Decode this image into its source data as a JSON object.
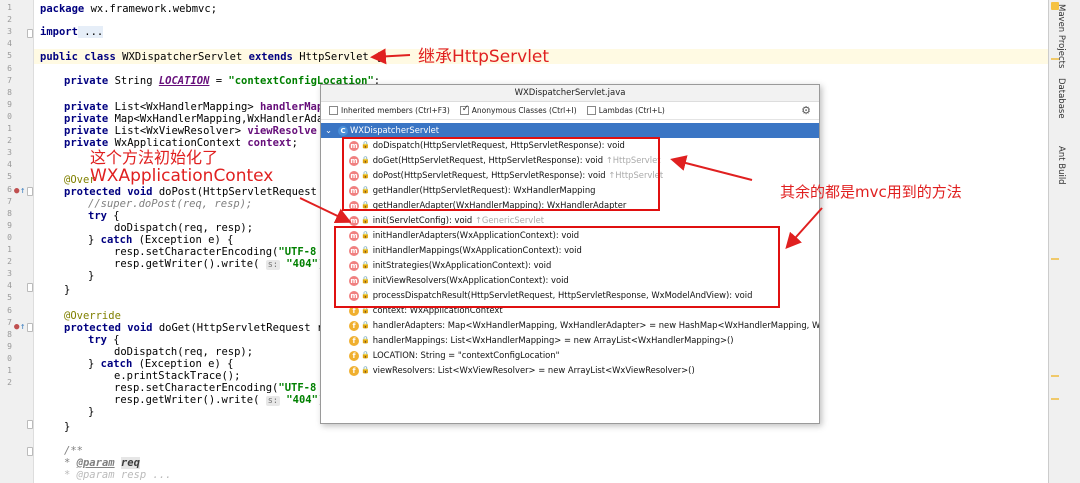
{
  "gutter": {
    "line_numbers": [
      "1",
      "2",
      "3",
      "4",
      "5",
      "6",
      "7",
      "8",
      "9",
      "0",
      "1",
      "2",
      "3",
      "4",
      "5",
      "6",
      "7",
      "8",
      "9",
      "0",
      "1",
      "2",
      "3",
      "4",
      "5",
      "6",
      "7",
      "8",
      "9",
      "0",
      "1",
      "2"
    ]
  },
  "code": {
    "l1": [
      "package",
      " wx.framework.webmvc;"
    ],
    "l3": [
      "import",
      " ..."
    ],
    "l5": [
      "public class",
      " WXDispatcherServlet ",
      "extends",
      " HttpServlet ",
      "{"
    ],
    "l7": [
      "private",
      " String ",
      "LOCATION",
      " = ",
      "\"contextConfigLocation\"",
      ";"
    ],
    "l9": [
      "private",
      " List<WxHandlerMapping> ",
      "handlerMap"
    ],
    "l10": [
      "private",
      " Map<WxHandlerMapping,WxHandlerAda"
    ],
    "l11": [
      "private",
      " List<WxViewResolver> ",
      "viewResolve"
    ],
    "l12": [
      "private",
      " WxApplicationContext ",
      "context",
      ";"
    ],
    "l14": "@Over",
    "l15": [
      "protected void",
      " doPost(HttpServletRequest"
    ],
    "l16": "//super.doPost(req, resp);",
    "l17": [
      "try",
      " {"
    ],
    "l18": "doDispatch(req, resp);",
    "l19": [
      "} ",
      "catch",
      " (Exception e) {"
    ],
    "l20": [
      "resp.setCharacterEncoding(",
      "\"UTF-8"
    ],
    "l21": [
      "resp.getWriter().write( ",
      "s:",
      " ",
      "\"404\"",
      ");"
    ],
    "l22": "}",
    "l23": "}",
    "l25": "@Override",
    "l26": [
      "protected void",
      " doGet(HttpServletRequest r"
    ],
    "l27": [
      "try",
      " {"
    ],
    "l28": "doDispatch(req, resp);",
    "l29": [
      "} ",
      "catch",
      " (Exception e) {"
    ],
    "l30": "e.printStackTrace();",
    "l31": [
      "resp.setCharacterEncoding(",
      "\"UTF-8"
    ],
    "l32": [
      "resp.getWriter().write( ",
      "s:",
      " ",
      "\"404\"",
      ");"
    ],
    "l33": "}",
    "l34": "}",
    "l36": "/**",
    "l37": [
      "* ",
      "@param",
      " ",
      "req"
    ],
    "l38": "* @param resp ..."
  },
  "popup": {
    "title": "WXDispatcherServlet.java",
    "opt_inherited": "Inherited members (Ctrl+F3)",
    "opt_anonymous": "Anonymous Classes (Ctrl+I)",
    "opt_lambdas": "Lambdas (Ctrl+L)",
    "items": [
      {
        "icon": "c",
        "text": "WXDispatcherServlet",
        "inh": "",
        "sel": true
      },
      {
        "icon": "m",
        "text": "doDispatch(HttpServletRequest, HttpServletResponse): void",
        "inh": ""
      },
      {
        "icon": "m",
        "text": "doGet(HttpServletRequest, HttpServletResponse): void ",
        "inh": "↑HttpServlet"
      },
      {
        "icon": "m",
        "text": "doPost(HttpServletRequest, HttpServletResponse): void ",
        "inh": "↑HttpServlet"
      },
      {
        "icon": "m",
        "text": "getHandler(HttpServletRequest): WxHandlerMapping",
        "inh": ""
      },
      {
        "icon": "m",
        "text": "getHandlerAdapter(WxHandlerMapping): WxHandlerAdapter",
        "inh": ""
      },
      {
        "icon": "m",
        "text": "init(ServletConfig): void ",
        "inh": "↑GenericServlet"
      },
      {
        "icon": "m",
        "text": "initHandlerAdapters(WxApplicationContext): void",
        "inh": ""
      },
      {
        "icon": "m",
        "text": "initHandlerMappings(WxApplicationContext): void",
        "inh": ""
      },
      {
        "icon": "m",
        "text": "initStrategies(WxApplicationContext): void",
        "inh": ""
      },
      {
        "icon": "m",
        "text": "initViewResolvers(WxApplicationContext): void",
        "inh": ""
      },
      {
        "icon": "m",
        "text": "processDispatchResult(HttpServletRequest, HttpServletResponse, WxModelAndView): void",
        "inh": ""
      },
      {
        "icon": "f",
        "text": "context: WxApplicationContext",
        "inh": ""
      },
      {
        "icon": "f",
        "text": "handlerAdapters: Map<WxHandlerMapping, WxHandlerAdapter> = new HashMap<WxHandlerMapping, W",
        "inh": ""
      },
      {
        "icon": "f",
        "text": "handlerMappings: List<WxHandlerMapping> = new ArrayList<WxHandlerMapping>()",
        "inh": ""
      },
      {
        "icon": "f",
        "text": "LOCATION: String = \"contextConfigLocation\"",
        "inh": ""
      },
      {
        "icon": "f",
        "text": "viewResolvers: List<WxViewResolver> = new ArrayList<WxViewResolver>()",
        "inh": ""
      }
    ]
  },
  "annotations": {
    "extends": "继承HttpServlet",
    "init_line1": "这个方法初始化了",
    "init_line2": "WXApplicationContex",
    "mvc": "其余的都是mvc用到的方法"
  },
  "right_strip": {
    "maven": "Maven Projects",
    "database": "Database",
    "ant": "Ant Build"
  },
  "colors": {
    "annotation": "#e02020",
    "selection": "#3a75c4",
    "method_icon": "#f08080",
    "field_icon": "#f0b030"
  }
}
